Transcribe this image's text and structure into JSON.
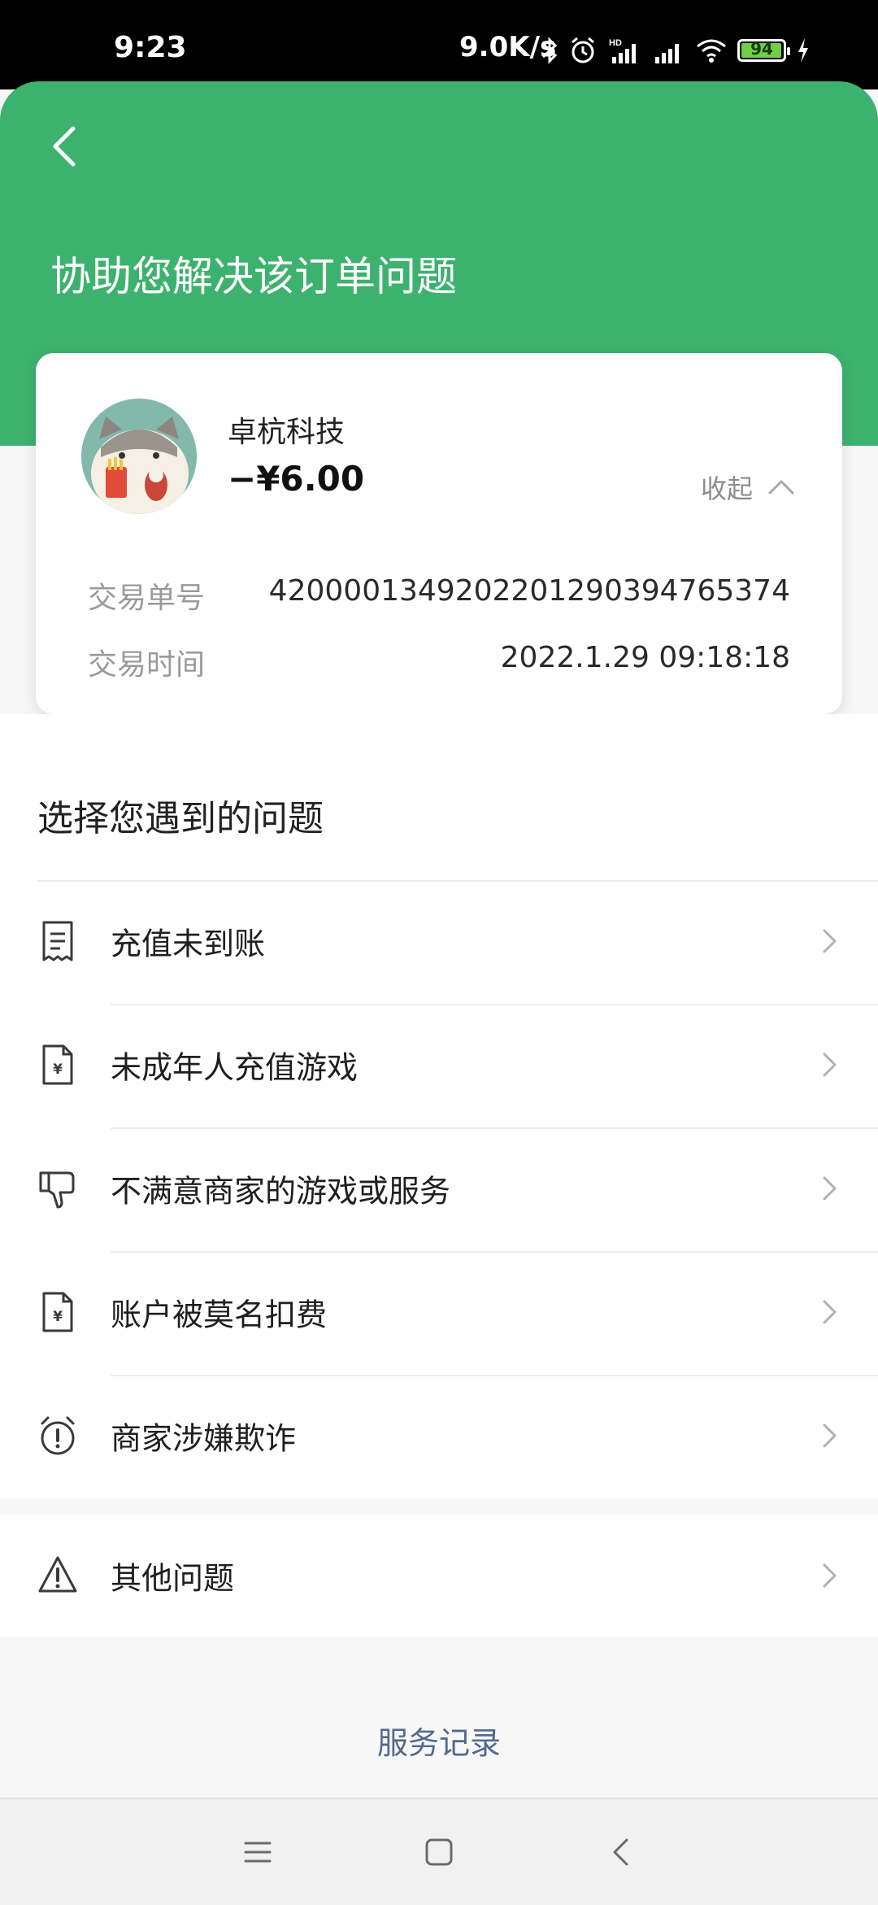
{
  "status_bar": {
    "time": "9:23",
    "network_speed": "9.0K/s",
    "battery": "94",
    "icons": [
      "bluetooth-icon",
      "alarm-icon",
      "hd-signal-icon",
      "signal-icon",
      "wifi-icon",
      "battery-icon",
      "charging-icon"
    ]
  },
  "header": {
    "title": "协助您解决该订单问题",
    "accent_color": "#3db26e"
  },
  "order": {
    "merchant": "卓杭科技",
    "amount": "−¥6.00",
    "collapse_label": "收起",
    "transaction_no_label": "交易单号",
    "transaction_no": "4200001349202201290394765374",
    "transaction_time_label": "交易时间",
    "transaction_time": "2022.1.29 09:18:18"
  },
  "issues": {
    "section_title": "选择您遇到的问题",
    "items": [
      {
        "label": "充值未到账",
        "icon": "receipt-icon"
      },
      {
        "label": "未成年人充值游戏",
        "icon": "yuan-document-icon"
      },
      {
        "label": "不满意商家的游戏或服务",
        "icon": "thumbs-down-icon"
      },
      {
        "label": "账户被莫名扣费",
        "icon": "yuan-document-icon"
      },
      {
        "label": "商家涉嫌欺诈",
        "icon": "alert-clock-icon"
      }
    ],
    "other": {
      "label": "其他问题",
      "icon": "warning-icon"
    }
  },
  "footer": {
    "service_record": "服务记录",
    "link_color": "#54698f"
  },
  "nav_bar": {
    "icons": [
      "menu-icon",
      "home-icon",
      "back-icon"
    ]
  }
}
